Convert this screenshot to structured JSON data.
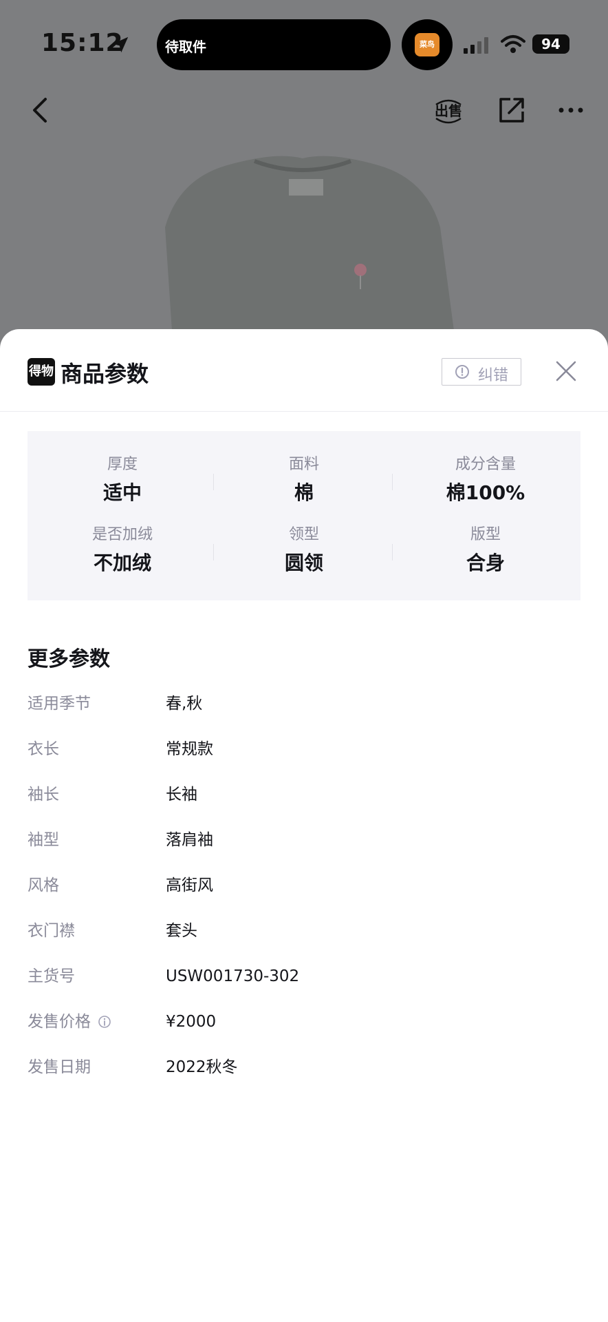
{
  "status_bar": {
    "time": "15:12",
    "island_text": "待取件",
    "island_badge": "菜鸟",
    "battery": "94"
  },
  "nav": {
    "back_icon": "chevron-left-icon",
    "sell_label": "出售",
    "share_icon": "share-icon",
    "more_icon": "more-dots-icon"
  },
  "sheet": {
    "logo_text": "得物",
    "title": "商品参数",
    "report_label": "纠错",
    "close_icon": "close-icon"
  },
  "key_params": [
    {
      "label": "厚度",
      "value": "适中"
    },
    {
      "label": "面料",
      "value": "棉"
    },
    {
      "label": "成分含量",
      "value": "棉100%"
    },
    {
      "label": "是否加绒",
      "value": "不加绒"
    },
    {
      "label": "领型",
      "value": "圆领"
    },
    {
      "label": "版型",
      "value": "合身"
    }
  ],
  "more": {
    "title": "更多参数",
    "rows": [
      {
        "label": "适用季节",
        "value": "春,秋"
      },
      {
        "label": "衣长",
        "value": "常规款"
      },
      {
        "label": "袖长",
        "value": "长袖"
      },
      {
        "label": "袖型",
        "value": "落肩袖"
      },
      {
        "label": "风格",
        "value": "高街风"
      },
      {
        "label": "衣门襟",
        "value": "套头"
      },
      {
        "label": "主货号",
        "value": "USW001730-302"
      },
      {
        "label": "发售价格",
        "value": "¥2000"
      },
      {
        "label": "发售日期",
        "value": "2022秋冬"
      }
    ]
  },
  "colors": {
    "overlay_bg": "#7d7e80",
    "sheet_bg": "#ffffff",
    "card_bg": "#f5f5f9",
    "label_gray": "#8a8a99",
    "text_dark": "#14151a"
  }
}
